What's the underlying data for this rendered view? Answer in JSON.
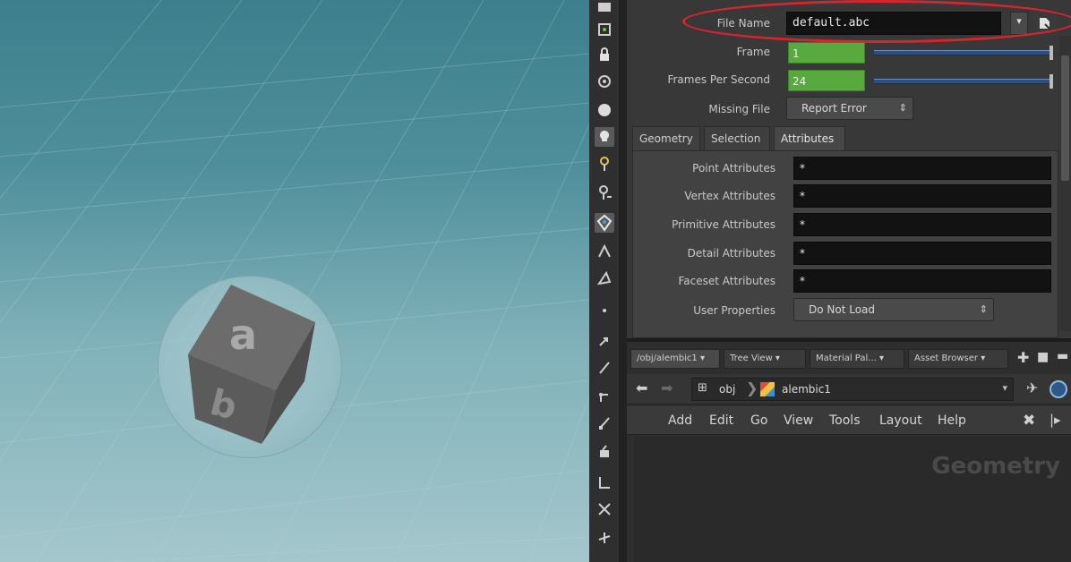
{
  "params": {
    "file_name_label": "File Name",
    "file_name_value": "default.abc",
    "frame_label": "Frame",
    "frame_value": "1",
    "fps_label": "Frames Per Second",
    "fps_value": "24",
    "missing_file_label": "Missing File",
    "missing_file_value": "Report Error",
    "tabs": [
      "Geometry",
      "Selection",
      "Attributes"
    ],
    "active_tab": "Attributes",
    "attributes": [
      {
        "label": "Point Attributes",
        "value": "*"
      },
      {
        "label": "Vertex Attributes",
        "value": "*"
      },
      {
        "label": "Primitive Attributes",
        "value": "*"
      },
      {
        "label": "Detail Attributes",
        "value": "*"
      },
      {
        "label": "Faceset Attributes",
        "value": "*"
      }
    ],
    "user_properties_label": "User Properties",
    "user_properties_value": "Do Not Load"
  },
  "network": {
    "tabs": [
      "/obj/alembic1",
      "Tree View",
      "Material Pal...",
      "Asset Browser"
    ],
    "path_root": "obj",
    "path_node": "alembic1",
    "menu": [
      "Add",
      "Edit",
      "Go",
      "View",
      "Tools",
      "Layout",
      "Help"
    ],
    "watermark": "Geometry"
  },
  "viewport": {
    "cube_face_top": "a",
    "cube_face_front": "b"
  },
  "colors": {
    "highlight_ring": "#d8242f",
    "num_field": "#58a93e",
    "slider": "#2d4f7c"
  }
}
